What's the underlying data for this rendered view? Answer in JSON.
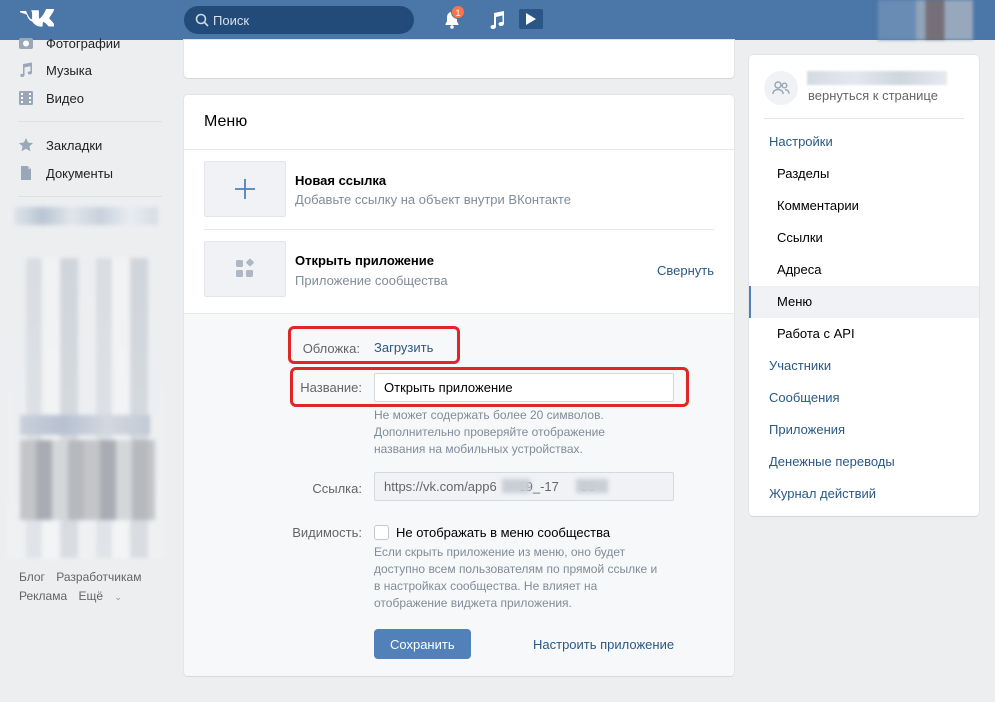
{
  "header": {
    "search_placeholder": "Поиск",
    "notifications_count": "1"
  },
  "left_nav": {
    "items": [
      {
        "label": "Фотографии",
        "icon": "camera-icon"
      },
      {
        "label": "Музыка",
        "icon": "music-note-icon"
      },
      {
        "label": "Видео",
        "icon": "video-icon"
      },
      {
        "label": "Закладки",
        "icon": "star-icon"
      },
      {
        "label": "Документы",
        "icon": "document-icon"
      }
    ],
    "footer": {
      "blog": "Блог",
      "developers": "Разработчикам",
      "ads": "Реклама",
      "more": "Ещё"
    }
  },
  "main": {
    "title": "Меню",
    "items": [
      {
        "title": "Новая ссылка",
        "description": "Добавьте ссылку на объект внутри ВКонтакте",
        "icon": "plus-icon"
      },
      {
        "title": "Открыть приложение",
        "description": "Приложение сообщества",
        "icon": "apps-icon"
      }
    ],
    "collapse_label": "Свернуть",
    "form": {
      "cover_label": "Обложка:",
      "cover_upload": "Загрузить",
      "name_label": "Название:",
      "name_value": "Открыть приложение",
      "name_hint": "Не может содержать более 20 символов.\nДополнительно проверяйте отображение\nназвания на мобильных устройствах.",
      "link_label": "Ссылка:",
      "link_value": "https://vk.com/app6      19_-17      03",
      "visibility_label": "Видимость:",
      "visibility_checkbox_label": "Не отображать в меню сообщества",
      "visibility_checked": false,
      "visibility_hint": "Если скрыть приложение из меню, оно будет\nдоступно всем пользователям по прямой ссылке и\nв настройках сообщества. Не влияет на\nотображение виджета приложения.",
      "save_label": "Сохранить",
      "configure_label": "Настроить приложение"
    }
  },
  "right_panel": {
    "back_label": "вернуться к странице",
    "items": [
      {
        "label": "Настройки",
        "level": "top"
      },
      {
        "label": "Разделы",
        "level": "sub"
      },
      {
        "label": "Комментарии",
        "level": "sub"
      },
      {
        "label": "Ссылки",
        "level": "sub"
      },
      {
        "label": "Адреса",
        "level": "sub"
      },
      {
        "label": "Меню",
        "level": "sub",
        "active": true
      },
      {
        "label": "Работа с API",
        "level": "sub"
      },
      {
        "label": "Участники",
        "level": "top"
      },
      {
        "label": "Сообщения",
        "level": "top"
      },
      {
        "label": "Приложения",
        "level": "top"
      },
      {
        "label": "Денежные переводы",
        "level": "top"
      },
      {
        "label": "Журнал действий",
        "level": "top"
      }
    ]
  },
  "colors": {
    "header_bg": "#4a76a8",
    "link": "#2a5885",
    "button": "#5181b8",
    "highlight_box": "#e02626"
  }
}
